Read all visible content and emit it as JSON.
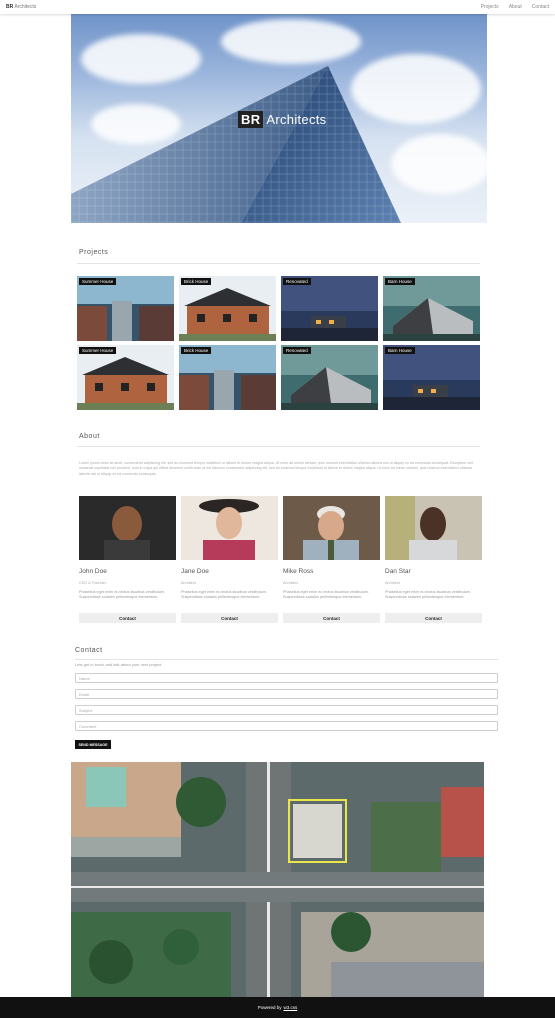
{
  "nav": {
    "brand_bold": "BR",
    "brand_rest": "Architects",
    "links": [
      "Projects",
      "About",
      "Contact"
    ]
  },
  "hero": {
    "badge": "BR",
    "title": "Architects"
  },
  "projects": {
    "heading": "Projects",
    "items": [
      {
        "label": "Summer House"
      },
      {
        "label": "Brick House"
      },
      {
        "label": "Renovated"
      },
      {
        "label": "Barn House"
      },
      {
        "label": "Summer House"
      },
      {
        "label": "Brick House"
      },
      {
        "label": "Renovated"
      },
      {
        "label": "Barn House"
      }
    ]
  },
  "about": {
    "heading": "About",
    "text": "Lorem ipsum dolor sit amet, consectetur adipiscing elit, sed do eiusmod tempor incididunt ut labore et dolore magna aliqua. Ut enim ad minim veniam, quis nostrud exercitation ullamco laboris nisi ut aliquip ex ea commodo consequat. Excepteur sint occaecat cupidatat non proident, sunt in culpa qui officia deserunt mollit anim id est laborum consectetur adipiscing elit, sed do eiusmod tempor incididunt ut labore et dolore magna aliqua. Ut enim ad minim veniam, quis nostrud exercitation ullamco laboris nisi ut aliquip ex ea commodo consequat.",
    "team": [
      {
        "name": "John Doe",
        "role": "CEO & Founder",
        "desc": "Phasellus eget enim eu lectus faucibus vestibulum. Suspendisse sodales pellentesque elementum.",
        "button": "Contact"
      },
      {
        "name": "Jane Doe",
        "role": "Architect",
        "desc": "Phasellus eget enim eu lectus faucibus vestibulum. Suspendisse sodales pellentesque elementum.",
        "button": "Contact"
      },
      {
        "name": "Mike Ross",
        "role": "Architect",
        "desc": "Phasellus eget enim eu lectus faucibus vestibulum. Suspendisse sodales pellentesque elementum.",
        "button": "Contact"
      },
      {
        "name": "Dan Star",
        "role": "Architect",
        "desc": "Phasellus eget enim eu lectus faucibus vestibulum. Suspendisse sodales pellentesque elementum.",
        "button": "Contact"
      }
    ]
  },
  "contact": {
    "heading": "Contact",
    "subtitle": "Lets get in touch and talk about your next project.",
    "fields": [
      "Name",
      "Email",
      "Subject",
      "Comment"
    ],
    "send": "SEND MESSAGE"
  },
  "footer": {
    "prefix": "Powered by",
    "link": "w3.css"
  }
}
